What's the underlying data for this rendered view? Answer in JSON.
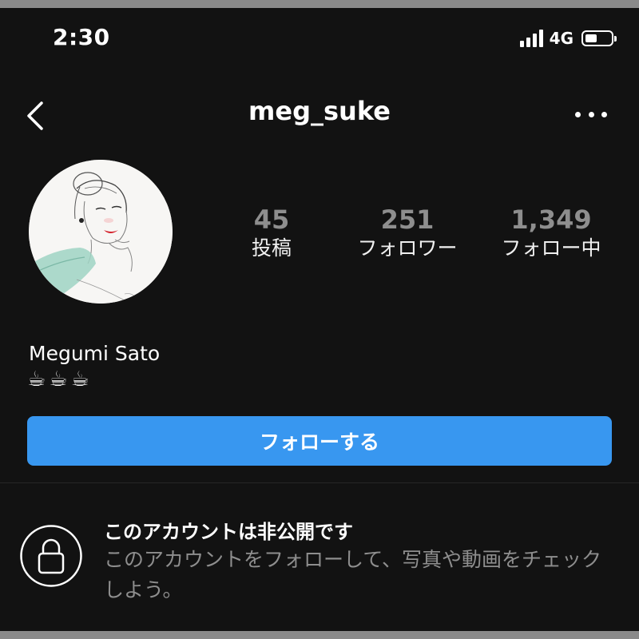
{
  "status_bar": {
    "time": "2:30",
    "network": "4G",
    "battery_level": 0.45,
    "signal_bars": 4
  },
  "header": {
    "back_icon": "chevron-left-icon",
    "username": "meg_suke",
    "more_icon": "ellipsis-icon"
  },
  "profile": {
    "avatar_icon": "illustrated-portrait",
    "stats": {
      "posts": {
        "value": "45",
        "label": "投稿"
      },
      "followers": {
        "value": "251",
        "label": "フォロワー"
      },
      "following": {
        "value": "1,349",
        "label": "フォロー中"
      }
    },
    "name": "Megumi Sato",
    "bio": "☕☕☕",
    "follow_button": "フォローする"
  },
  "private_notice": {
    "icon": "lock-icon",
    "title": "このアカウントは非公開です",
    "description": "このアカウントをフォローして、写真や動画をチェックしよう。"
  },
  "colors": {
    "background": "#121212",
    "accent": "#3897f0",
    "muted_text": "#8e8e8e"
  }
}
